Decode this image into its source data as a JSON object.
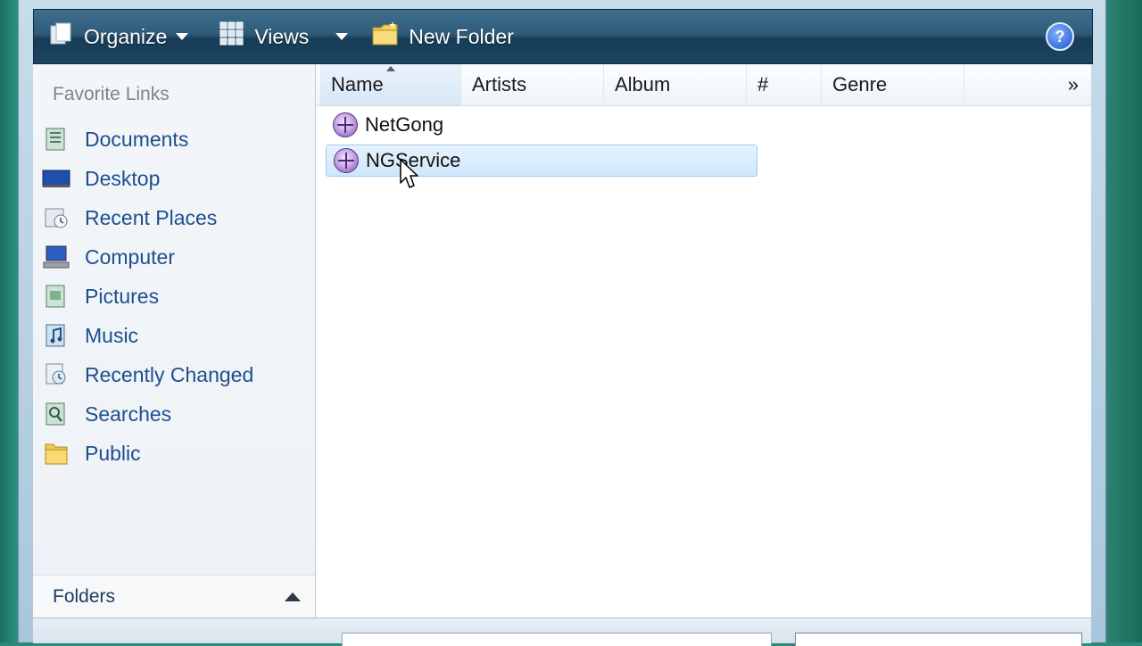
{
  "toolbar": {
    "organize_label": "Organize",
    "views_label": "Views",
    "new_folder_label": "New Folder",
    "help_label": "?"
  },
  "nav": {
    "heading": "Favorite Links",
    "items": [
      {
        "label": "Documents",
        "icon": "documents-icon"
      },
      {
        "label": "Desktop",
        "icon": "desktop-icon"
      },
      {
        "label": "Recent Places",
        "icon": "recent-places-icon"
      },
      {
        "label": "Computer",
        "icon": "computer-icon"
      },
      {
        "label": "Pictures",
        "icon": "pictures-icon"
      },
      {
        "label": "Music",
        "icon": "music-icon"
      },
      {
        "label": "Recently Changed",
        "icon": "recently-changed-icon"
      },
      {
        "label": "Searches",
        "icon": "searches-icon"
      },
      {
        "label": "Public",
        "icon": "public-folder-icon"
      }
    ],
    "folders_label": "Folders"
  },
  "columns": {
    "name": "Name",
    "artists": "Artists",
    "album": "Album",
    "number": "#",
    "genre": "Genre",
    "more": "»"
  },
  "files": [
    {
      "name": "NetGong",
      "selected": false
    },
    {
      "name": "NGService",
      "selected": true
    }
  ],
  "colors": {
    "toolbar": "#2f5b79",
    "link_text": "#1d4f8f",
    "selection": "#cfe6fb"
  }
}
